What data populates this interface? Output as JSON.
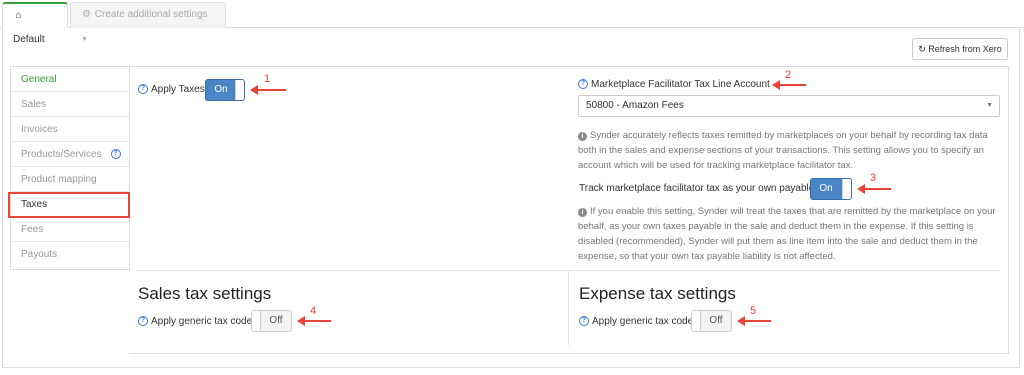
{
  "tabs": [
    {
      "label": "Default",
      "icon": "home-icon"
    },
    {
      "label": "Create additional settings",
      "icon": "gear-icon"
    }
  ],
  "toolbar": {
    "refresh_label": "Refresh from Xero",
    "refresh_icon": "refresh-icon"
  },
  "sidebar": {
    "items": [
      {
        "label": "General",
        "state": "active"
      },
      {
        "label": "Sales"
      },
      {
        "label": "Invoices"
      },
      {
        "label": "Products/Services",
        "help": true
      },
      {
        "label": "Product mapping"
      },
      {
        "label": "Taxes",
        "state": "selected"
      },
      {
        "label": "Fees"
      },
      {
        "label": "Payouts"
      }
    ]
  },
  "apply_taxes": {
    "label": "Apply Taxes",
    "toggle": "On"
  },
  "marketplace": {
    "label": "Marketplace Facilitator Tax Line Account",
    "select_value": "50800 - Amazon Fees",
    "info_text": "Synder accurately reflects taxes remitted by marketplaces on your behalf by recording tax data both in the sales and expense sections of your transactions. This setting allows you to specify an account which will be used for tracking marketplace facilitator tax.",
    "track_label": "Track marketplace facilitator tax as your own payable",
    "track_toggle": "On",
    "track_info": "If you enable this setting, Synder will treat the taxes that are remitted by the marketplace on your behalf, as your own taxes payable in the sale and deduct them in the expense. If this setting is disabled (recommended), Synder will put them as line item into the sale and deduct them in the expense, so that your own tax payable liability is not affected."
  },
  "sales_tax": {
    "title": "Sales tax settings",
    "label": "Apply generic tax code",
    "toggle": "Off"
  },
  "expense_tax": {
    "title": "Expense tax settings",
    "label": "Apply generic tax code",
    "toggle": "Off"
  },
  "annotations": [
    "1",
    "2",
    "3",
    "4",
    "5"
  ],
  "colors": {
    "accent": "#4a86c5",
    "active_tab": "#3ca03c",
    "annotation": "#e8443a"
  }
}
